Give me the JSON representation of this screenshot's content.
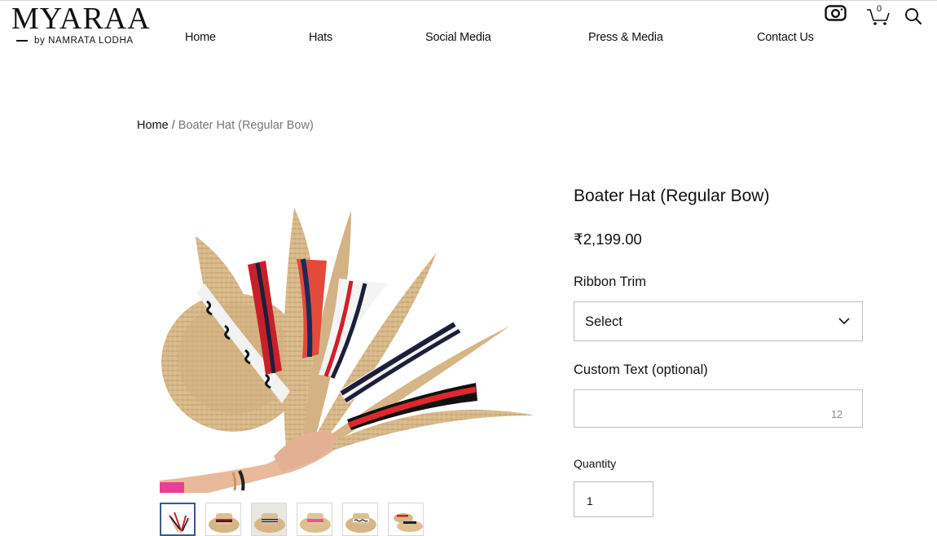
{
  "brand": {
    "name": "MYARAA",
    "tagline": "by NAMRATA LODHA"
  },
  "nav": {
    "items": [
      {
        "label": "Home"
      },
      {
        "label": "Hats"
      },
      {
        "label": "Social Media"
      },
      {
        "label": "Press & Media"
      },
      {
        "label": "Contact Us"
      }
    ]
  },
  "header": {
    "cart_count": "0",
    "icons": [
      "instagram-icon",
      "cart-icon",
      "search-icon"
    ]
  },
  "breadcrumb": {
    "home": "Home",
    "separator": "/",
    "current": "Boater Hat (Regular Bow)"
  },
  "product": {
    "title": "Boater Hat (Regular Bow)",
    "price": "₹2,199.00",
    "ribbon_label": "Ribbon Trim",
    "ribbon_value": "Select",
    "custom_text_label": "Custom Text (optional)",
    "custom_text_value": "",
    "custom_text_remaining": "12",
    "quantity_label": "Quantity",
    "quantity_value": "1"
  },
  "gallery": {
    "thumbnail_count": 6,
    "selected_thumbnail": 1
  },
  "colors": {
    "text": "#111111",
    "border": "#bdbdbd",
    "thumb_active": "#3a5a8a",
    "straw": "#d9b98c"
  }
}
